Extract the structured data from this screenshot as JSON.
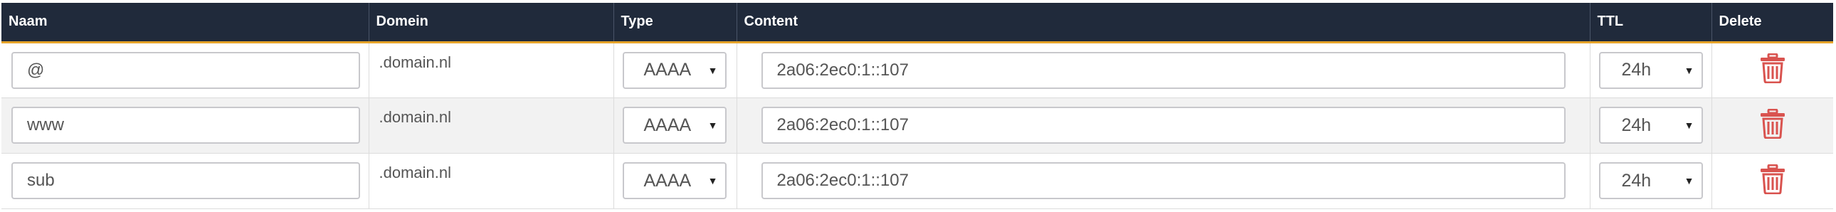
{
  "headers": {
    "name": "Naam",
    "domain": "Domein",
    "type": "Type",
    "content": "Content",
    "ttl": "TTL",
    "delete": "Delete"
  },
  "colors": {
    "header_bg": "#202a3b",
    "header_accent": "#e6a32a",
    "delete_icon": "#d9534f",
    "row_alt_bg": "#f2f2f2"
  },
  "rows": [
    {
      "name": "@",
      "domain": ".domain.nl",
      "type": "AAAA",
      "content": "2a06:2ec0:1::107",
      "ttl": "24h",
      "delete_icon": "trash-icon"
    },
    {
      "name": "www",
      "domain": ".domain.nl",
      "type": "AAAA",
      "content": "2a06:2ec0:1::107",
      "ttl": "24h",
      "delete_icon": "trash-icon"
    },
    {
      "name": "sub",
      "domain": ".domain.nl",
      "type": "AAAA",
      "content": "2a06:2ec0:1::107",
      "ttl": "24h",
      "delete_icon": "trash-icon"
    }
  ]
}
